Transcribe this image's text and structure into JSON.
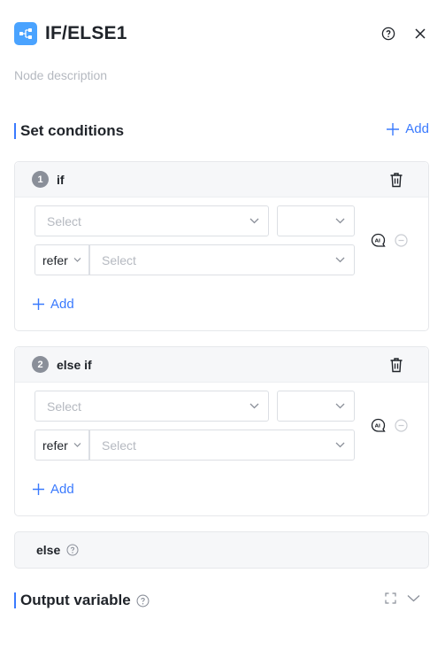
{
  "header": {
    "title": "IF/ELSE1",
    "node_icon": "branch-node-icon",
    "help_icon": "question-circle-icon",
    "close_icon": "close-icon",
    "accent_color": "#4aa3ff"
  },
  "description": {
    "placeholder": "Node description"
  },
  "conditions": {
    "title": "Set conditions",
    "add_label": "Add",
    "cases": [
      {
        "number": "1",
        "label": "if",
        "left_select_placeholder": "Select",
        "operator_select_value": "",
        "refer_label": "refer",
        "value_select_placeholder": "Select",
        "add_label": "Add"
      },
      {
        "number": "2",
        "label": "else if",
        "left_select_placeholder": "Select",
        "operator_select_value": "",
        "refer_label": "refer",
        "value_select_placeholder": "Select",
        "add_label": "Add"
      }
    ],
    "else_label": "else"
  },
  "output": {
    "title": "Output variable",
    "expand_icon": "expand-icon",
    "collapse_icon": "chevron-down-icon"
  },
  "colors": {
    "link": "#3a7afe",
    "badge": "#8a8f99",
    "placeholder": "#b5b9c0"
  }
}
